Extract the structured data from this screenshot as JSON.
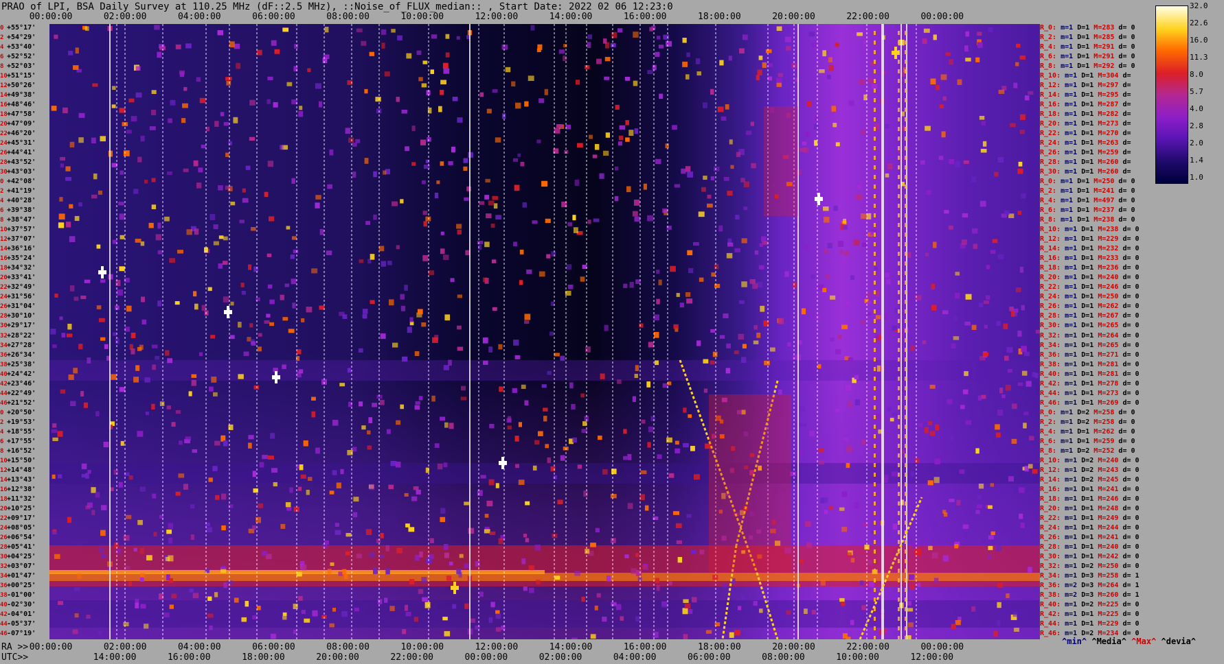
{
  "title": "PRAO of LPI, BSA Daily Survey at 110.25 MHz (dF::2.5 MHz), ::Noise_of_FLUX_median:: , Start Date: 2022 02 06 12:23:0",
  "top_axis_ticks": [
    "00:00:00",
    "02:00:00",
    "04:00:00",
    "06:00:00",
    "08:00:00",
    "10:00:00",
    "12:00:00",
    "14:00:00",
    "16:00:00",
    "18:00:00",
    "20:00:00",
    "22:00:00",
    "00:00:00"
  ],
  "bottom_axis": {
    "ra_prefix": "RA >>",
    "ra_ticks": [
      "00:00:00",
      "02:00:00",
      "04:00:00",
      "06:00:00",
      "08:00:00",
      "10:00:00",
      "12:00:00",
      "14:00:00",
      "16:00:00",
      "18:00:00",
      "20:00:00",
      "22:00:00",
      "00:00:00"
    ],
    "utc_prefix": "UTC>>",
    "utc_ticks": [
      "14:00:00",
      "16:00:00",
      "18:00:00",
      "20:00:00",
      "22:00:00",
      "00:00:00",
      "02:00:00",
      "04:00:00",
      "06:00:00",
      "08:00:00",
      "10:00:00",
      "12:00:00"
    ]
  },
  "legend": {
    "min": "^min^",
    "median": "^Media^",
    "max": "^Max^",
    "deviation": "^devia^"
  },
  "colorbar_ticks": [
    "32.0",
    "22.6",
    "16.0",
    "11.3",
    "8.0",
    "5.7",
    "4.0",
    "2.8",
    "2.0",
    "1.4",
    "1.0"
  ],
  "colors": {
    "background": "#a8a8a8",
    "low": "#00003c",
    "mid": "#8c1ec8",
    "high": "#ffd21e",
    "peak": "#ffffe6",
    "label_red": "#d00000",
    "label_blue": "#00006a"
  },
  "chart_data": {
    "type": "heatmap",
    "title": "PRAO of LPI, BSA Daily Survey at 110.25 MHz (dF::2.5 MHz), ::Noise_of_FLUX_median:: , Start Date: 2022 02 06 12:23:0",
    "xlabel": "RA / UTC",
    "x_range": [
      "00:00:00",
      "24:00:00"
    ],
    "colorscale_range": [
      1.0,
      32.0
    ],
    "declinations": [
      "+55°17'",
      "+54°29'",
      "+53°40'",
      "+52°52'",
      "+52°03'",
      "+51°15'",
      "+50°26'",
      "+49°38'",
      "+48°46'",
      "+47°58'",
      "+47°09'",
      "+46°20'",
      "+45°31'",
      "+44°41'",
      "+43°52'",
      "+43°03'",
      "+42°08'",
      "+41°19'",
      "+40°28'",
      "+39°38'",
      "+38°47'",
      "+37°57'",
      "+37°07'",
      "+36°16'",
      "+35°24'",
      "+34°32'",
      "+33°41'",
      "+32°49'",
      "+31°56'",
      "+31°04'",
      "+30°10'",
      "+29°17'",
      "+28°22'",
      "+27°28'",
      "+26°34'",
      "+25°38'",
      "+24°42'",
      "+23°46'",
      "+22°49'",
      "+21°52'",
      "+20°50'",
      "+19°53'",
      "+18°55'",
      "+17°55'",
      "+16°52'",
      "+15°50'",
      "+14°48'",
      "+13°43'",
      "+12°38'",
      "+11°32'",
      "+10°25'",
      "+09°17'",
      "+08°05'",
      "+06°54'",
      "+05°41'",
      "+04°25'",
      "+03°07'",
      "+01°47'",
      "+00°25'",
      "-01°00'",
      "-02°30'",
      "-04°01'",
      "-05°37'",
      "-07°19'"
    ],
    "row_indices": [
      "0",
      "2",
      "4",
      "6",
      "8",
      "10",
      "12",
      "14",
      "16",
      "18",
      "20",
      "22",
      "24",
      "26",
      "28",
      "30",
      "0",
      "2",
      "4",
      "6",
      "8",
      "10",
      "12",
      "14",
      "16",
      "18",
      "20",
      "22",
      "24",
      "26",
      "28",
      "30",
      "32",
      "34",
      "36",
      "38",
      "40",
      "42",
      "44",
      "46",
      "0",
      "2",
      "4",
      "6",
      "8",
      "10",
      "12",
      "14",
      "16",
      "18",
      "20",
      "22",
      "24",
      "26",
      "28",
      "30",
      "32",
      "34",
      "36",
      "38",
      "40",
      "42",
      "44",
      "46"
    ],
    "receivers": [
      {
        "name": "R_0:",
        "m": "m=1",
        "D": "D=1",
        "M": "M=283",
        "d": "d= 0"
      },
      {
        "name": "R_2:",
        "m": "m=1",
        "D": "D=1",
        "M": "M=285",
        "d": "d= 0"
      },
      {
        "name": "R_4:",
        "m": "m=1",
        "D": "D=1",
        "M": "M=291",
        "d": "d= 0"
      },
      {
        "name": "R_6:",
        "m": "m=1",
        "D": "D=1",
        "M": "M=291",
        "d": "d= 0"
      },
      {
        "name": "R_8:",
        "m": "m=1",
        "D": "D=1",
        "M": "M=292",
        "d": "d= 0"
      },
      {
        "name": "R_10:",
        "m": "m=1",
        "D": "D=1",
        "M": "M=304",
        "d": "d="
      },
      {
        "name": "R_12:",
        "m": "m=1",
        "D": "D=1",
        "M": "M=297",
        "d": "d="
      },
      {
        "name": "R_14:",
        "m": "m=1",
        "D": "D=1",
        "M": "M=295",
        "d": "d="
      },
      {
        "name": "R_16:",
        "m": "m=1",
        "D": "D=1",
        "M": "M=287",
        "d": "d="
      },
      {
        "name": "R_18:",
        "m": "m=1",
        "D": "D=1",
        "M": "M=282",
        "d": "d="
      },
      {
        "name": "R_20:",
        "m": "m=1",
        "D": "D=1",
        "M": "M=273",
        "d": "d="
      },
      {
        "name": "R_22:",
        "m": "m=1",
        "D": "D=1",
        "M": "M=270",
        "d": "d="
      },
      {
        "name": "R_24:",
        "m": "m=1",
        "D": "D=1",
        "M": "M=263",
        "d": "d="
      },
      {
        "name": "R_26:",
        "m": "m=1",
        "D": "D=1",
        "M": "M=259",
        "d": "d="
      },
      {
        "name": "R_28:",
        "m": "m=1",
        "D": "D=1",
        "M": "M=260",
        "d": "d="
      },
      {
        "name": "R_30:",
        "m": "m=1",
        "D": "D=1",
        "M": "M=260",
        "d": "d="
      },
      {
        "name": "R_0:",
        "m": "m=1",
        "D": "D=1",
        "M": "M=250",
        "d": "d= 0"
      },
      {
        "name": "R_2:",
        "m": "m=1",
        "D": "D=1",
        "M": "M=241",
        "d": "d= 0"
      },
      {
        "name": "R_4:",
        "m": "m=1",
        "D": "D=1",
        "M": "M=497",
        "d": "d= 0"
      },
      {
        "name": "R_6:",
        "m": "m=1",
        "D": "D=1",
        "M": "M=237",
        "d": "d= 0"
      },
      {
        "name": "R_8:",
        "m": "m=1",
        "D": "D=1",
        "M": "M=238",
        "d": "d= 0"
      },
      {
        "name": "R_10:",
        "m": "m=1",
        "D": "D=1",
        "M": "M=238",
        "d": "d= 0"
      },
      {
        "name": "R_12:",
        "m": "m=1",
        "D": "D=1",
        "M": "M=229",
        "d": "d= 0"
      },
      {
        "name": "R_14:",
        "m": "m=1",
        "D": "D=1",
        "M": "M=232",
        "d": "d= 0"
      },
      {
        "name": "R_16:",
        "m": "m=1",
        "D": "D=1",
        "M": "M=233",
        "d": "d= 0"
      },
      {
        "name": "R_18:",
        "m": "m=1",
        "D": "D=1",
        "M": "M=236",
        "d": "d= 0"
      },
      {
        "name": "R_20:",
        "m": "m=1",
        "D": "D=1",
        "M": "M=240",
        "d": "d= 0"
      },
      {
        "name": "R_22:",
        "m": "m=1",
        "D": "D=1",
        "M": "M=246",
        "d": "d= 0"
      },
      {
        "name": "R_24:",
        "m": "m=1",
        "D": "D=1",
        "M": "M=250",
        "d": "d= 0"
      },
      {
        "name": "R_26:",
        "m": "m=1",
        "D": "D=1",
        "M": "M=262",
        "d": "d= 0"
      },
      {
        "name": "R_28:",
        "m": "m=1",
        "D": "D=1",
        "M": "M=267",
        "d": "d= 0"
      },
      {
        "name": "R_30:",
        "m": "m=1",
        "D": "D=1",
        "M": "M=265",
        "d": "d= 0"
      },
      {
        "name": "R_32:",
        "m": "m=1",
        "D": "D=1",
        "M": "M=264",
        "d": "d= 0"
      },
      {
        "name": "R_34:",
        "m": "m=1",
        "D": "D=1",
        "M": "M=265",
        "d": "d= 0"
      },
      {
        "name": "R_36:",
        "m": "m=1",
        "D": "D=1",
        "M": "M=271",
        "d": "d= 0"
      },
      {
        "name": "R_38:",
        "m": "m=1",
        "D": "D=1",
        "M": "M=281",
        "d": "d= 0"
      },
      {
        "name": "R_40:",
        "m": "m=1",
        "D": "D=1",
        "M": "M=281",
        "d": "d= 0"
      },
      {
        "name": "R_42:",
        "m": "m=1",
        "D": "D=1",
        "M": "M=278",
        "d": "d= 0"
      },
      {
        "name": "R_44:",
        "m": "m=1",
        "D": "D=1",
        "M": "M=273",
        "d": "d= 0"
      },
      {
        "name": "R_46:",
        "m": "m=1",
        "D": "D=1",
        "M": "M=269",
        "d": "d= 0"
      },
      {
        "name": "R_0:",
        "m": "m=1",
        "D": "D=2",
        "M": "M=258",
        "d": "d= 0"
      },
      {
        "name": "R_2:",
        "m": "m=1",
        "D": "D=2",
        "M": "M=258",
        "d": "d= 0"
      },
      {
        "name": "R_4:",
        "m": "m=1",
        "D": "D=1",
        "M": "M=262",
        "d": "d= 0"
      },
      {
        "name": "R_6:",
        "m": "m=1",
        "D": "D=1",
        "M": "M=259",
        "d": "d= 0"
      },
      {
        "name": "R_8:",
        "m": "m=1",
        "D": "D=2",
        "M": "M=252",
        "d": "d= 0"
      },
      {
        "name": "R_10:",
        "m": "m=1",
        "D": "D=2",
        "M": "M=240",
        "d": "d= 0"
      },
      {
        "name": "R_12:",
        "m": "m=1",
        "D": "D=2",
        "M": "M=243",
        "d": "d= 0"
      },
      {
        "name": "R_14:",
        "m": "m=1",
        "D": "D=2",
        "M": "M=245",
        "d": "d= 0"
      },
      {
        "name": "R_16:",
        "m": "m=1",
        "D": "D=1",
        "M": "M=241",
        "d": "d= 0"
      },
      {
        "name": "R_18:",
        "m": "m=1",
        "D": "D=1",
        "M": "M=246",
        "d": "d= 0"
      },
      {
        "name": "R_20:",
        "m": "m=1",
        "D": "D=1",
        "M": "M=248",
        "d": "d= 0"
      },
      {
        "name": "R_22:",
        "m": "m=1",
        "D": "D=1",
        "M": "M=249",
        "d": "d= 0"
      },
      {
        "name": "R_24:",
        "m": "m=1",
        "D": "D=1",
        "M": "M=244",
        "d": "d= 0"
      },
      {
        "name": "R_26:",
        "m": "m=1",
        "D": "D=1",
        "M": "M=241",
        "d": "d= 0"
      },
      {
        "name": "R_28:",
        "m": "m=1",
        "D": "D=1",
        "M": "M=240",
        "d": "d= 0"
      },
      {
        "name": "R_30:",
        "m": "m=1",
        "D": "D=1",
        "M": "M=242",
        "d": "d= 0"
      },
      {
        "name": "R_32:",
        "m": "m=1",
        "D": "D=2",
        "M": "M=250",
        "d": "d= 0"
      },
      {
        "name": "R_34:",
        "m": "m=1",
        "D": "D=3",
        "M": "M=258",
        "d": "d= 1"
      },
      {
        "name": "R_36:",
        "m": "m=2",
        "D": "D=3",
        "M": "M=264",
        "d": "d= 1"
      },
      {
        "name": "R_38:",
        "m": "m=2",
        "D": "D=3",
        "M": "M=260",
        "d": "d= 1"
      },
      {
        "name": "R_40:",
        "m": "m=1",
        "D": "D=2",
        "M": "M=225",
        "d": "d= 0"
      },
      {
        "name": "R_42:",
        "m": "m=1",
        "D": "D=1",
        "M": "M=225",
        "d": "d= 0"
      },
      {
        "name": "R_44:",
        "m": "m=1",
        "D": "D=1",
        "M": "M=229",
        "d": "d= 0"
      },
      {
        "name": "R_46:",
        "m": "m=1",
        "D": "D=2",
        "M": "M=234",
        "d": "d= 0"
      }
    ]
  }
}
